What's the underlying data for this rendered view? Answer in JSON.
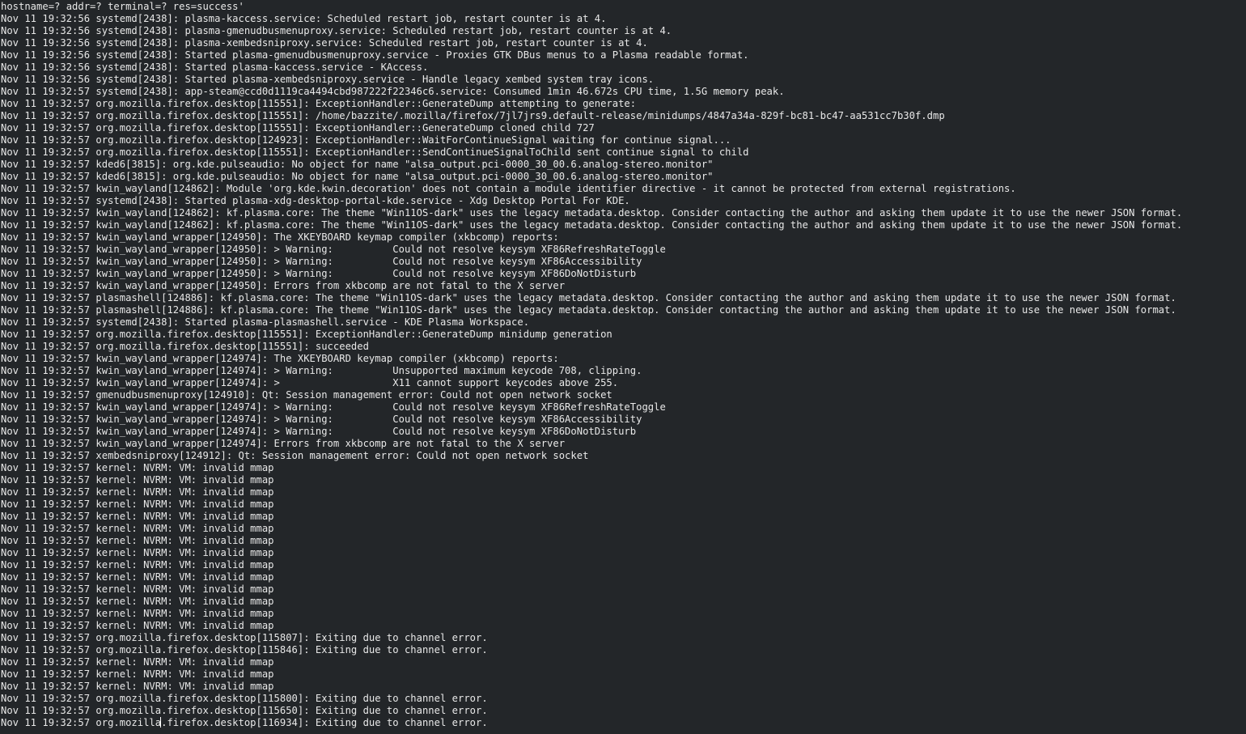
{
  "terminal": {
    "lines": [
      "hostname=? addr=? terminal=? res=success'",
      "Nov 11 19:32:56 systemd[2438]: plasma-kaccess.service: Scheduled restart job, restart counter is at 4.",
      "Nov 11 19:32:56 systemd[2438]: plasma-gmenudbusmenuproxy.service: Scheduled restart job, restart counter is at 4.",
      "Nov 11 19:32:56 systemd[2438]: plasma-xembedsniproxy.service: Scheduled restart job, restart counter is at 4.",
      "Nov 11 19:32:56 systemd[2438]: Started plasma-gmenudbusmenuproxy.service - Proxies GTK DBus menus to a Plasma readable format.",
      "Nov 11 19:32:56 systemd[2438]: Started plasma-kaccess.service - KAccess.",
      "Nov 11 19:32:56 systemd[2438]: Started plasma-xembedsniproxy.service - Handle legacy xembed system tray icons.",
      "Nov 11 19:32:57 systemd[2438]: app-steam@ccd0d1119ca4494cbd987222f22346c6.service: Consumed 1min 46.672s CPU time, 1.5G memory peak.",
      "Nov 11 19:32:57 org.mozilla.firefox.desktop[115551]: ExceptionHandler::GenerateDump attempting to generate:",
      "Nov 11 19:32:57 org.mozilla.firefox.desktop[115551]: /home/bazzite/.mozilla/firefox/7jl7jrs9.default-release/minidumps/4847a34a-829f-bc81-bc47-aa531cc7b30f.dmp",
      "Nov 11 19:32:57 org.mozilla.firefox.desktop[115551]: ExceptionHandler::GenerateDump cloned child 727",
      "Nov 11 19:32:57 org.mozilla.firefox.desktop[124923]: ExceptionHandler::WaitForContinueSignal waiting for continue signal...",
      "Nov 11 19:32:57 org.mozilla.firefox.desktop[115551]: ExceptionHandler::SendContinueSignalToChild sent continue signal to child",
      "Nov 11 19:32:57 kded6[3815]: org.kde.pulseaudio: No object for name \"alsa_output.pci-0000_30_00.6.analog-stereo.monitor\"",
      "Nov 11 19:32:57 kded6[3815]: org.kde.pulseaudio: No object for name \"alsa_output.pci-0000_30_00.6.analog-stereo.monitor\"",
      "Nov 11 19:32:57 kwin_wayland[124862]: Module 'org.kde.kwin.decoration' does not contain a module identifier directive - it cannot be protected from external registrations.",
      "Nov 11 19:32:57 systemd[2438]: Started plasma-xdg-desktop-portal-kde.service - Xdg Desktop Portal For KDE.",
      "Nov 11 19:32:57 kwin_wayland[124862]: kf.plasma.core: The theme \"Win11OS-dark\" uses the legacy metadata.desktop. Consider contacting the author and asking them update it to use the newer JSON format.",
      "Nov 11 19:32:57 kwin_wayland[124862]: kf.plasma.core: The theme \"Win11OS-dark\" uses the legacy metadata.desktop. Consider contacting the author and asking them update it to use the newer JSON format.",
      "Nov 11 19:32:57 kwin_wayland_wrapper[124950]: The XKEYBOARD keymap compiler (xkbcomp) reports:",
      "Nov 11 19:32:57 kwin_wayland_wrapper[124950]: > Warning:          Could not resolve keysym XF86RefreshRateToggle",
      "Nov 11 19:32:57 kwin_wayland_wrapper[124950]: > Warning:          Could not resolve keysym XF86Accessibility",
      "Nov 11 19:32:57 kwin_wayland_wrapper[124950]: > Warning:          Could not resolve keysym XF86DoNotDisturb",
      "Nov 11 19:32:57 kwin_wayland_wrapper[124950]: Errors from xkbcomp are not fatal to the X server",
      "Nov 11 19:32:57 plasmashell[124886]: kf.plasma.core: The theme \"Win11OS-dark\" uses the legacy metadata.desktop. Consider contacting the author and asking them update it to use the newer JSON format.",
      "Nov 11 19:32:57 plasmashell[124886]: kf.plasma.core: The theme \"Win11OS-dark\" uses the legacy metadata.desktop. Consider contacting the author and asking them update it to use the newer JSON format.",
      "Nov 11 19:32:57 systemd[2438]: Started plasma-plasmashell.service - KDE Plasma Workspace.",
      "Nov 11 19:32:57 org.mozilla.firefox.desktop[115551]: ExceptionHandler::GenerateDump minidump generation",
      "Nov 11 19:32:57 org.mozilla.firefox.desktop[115551]: succeeded",
      "Nov 11 19:32:57 kwin_wayland_wrapper[124974]: The XKEYBOARD keymap compiler (xkbcomp) reports:",
      "Nov 11 19:32:57 kwin_wayland_wrapper[124974]: > Warning:          Unsupported maximum keycode 708, clipping.",
      "Nov 11 19:32:57 kwin_wayland_wrapper[124974]: >                   X11 cannot support keycodes above 255.",
      "Nov 11 19:32:57 gmenudbusmenuproxy[124910]: Qt: Session management error: Could not open network socket",
      "Nov 11 19:32:57 kwin_wayland_wrapper[124974]: > Warning:          Could not resolve keysym XF86RefreshRateToggle",
      "Nov 11 19:32:57 kwin_wayland_wrapper[124974]: > Warning:          Could not resolve keysym XF86Accessibility",
      "Nov 11 19:32:57 kwin_wayland_wrapper[124974]: > Warning:          Could not resolve keysym XF86DoNotDisturb",
      "Nov 11 19:32:57 kwin_wayland_wrapper[124974]: Errors from xkbcomp are not fatal to the X server",
      "Nov 11 19:32:57 xembedsniproxy[124912]: Qt: Session management error: Could not open network socket",
      "Nov 11 19:32:57 kernel: NVRM: VM: invalid mmap",
      "Nov 11 19:32:57 kernel: NVRM: VM: invalid mmap",
      "Nov 11 19:32:57 kernel: NVRM: VM: invalid mmap",
      "Nov 11 19:32:57 kernel: NVRM: VM: invalid mmap",
      "Nov 11 19:32:57 kernel: NVRM: VM: invalid mmap",
      "Nov 11 19:32:57 kernel: NVRM: VM: invalid mmap",
      "Nov 11 19:32:57 kernel: NVRM: VM: invalid mmap",
      "Nov 11 19:32:57 kernel: NVRM: VM: invalid mmap",
      "Nov 11 19:32:57 kernel: NVRM: VM: invalid mmap",
      "Nov 11 19:32:57 kernel: NVRM: VM: invalid mmap",
      "Nov 11 19:32:57 kernel: NVRM: VM: invalid mmap",
      "Nov 11 19:32:57 kernel: NVRM: VM: invalid mmap",
      "Nov 11 19:32:57 kernel: NVRM: VM: invalid mmap",
      "Nov 11 19:32:57 kernel: NVRM: VM: invalid mmap",
      "Nov 11 19:32:57 org.mozilla.firefox.desktop[115807]: Exiting due to channel error.",
      "Nov 11 19:32:57 org.mozilla.firefox.desktop[115846]: Exiting due to channel error.",
      "Nov 11 19:32:57 kernel: NVRM: VM: invalid mmap",
      "Nov 11 19:32:57 kernel: NVRM: VM: invalid mmap",
      "Nov 11 19:32:57 kernel: NVRM: VM: invalid mmap",
      "Nov 11 19:32:57 org.mozilla.firefox.desktop[115800]: Exiting due to channel error.",
      "Nov 11 19:32:57 org.mozilla.firefox.desktop[115650]: Exiting due to channel error.",
      "Nov 11 19:32:57 org.mozilla.firefox.desktop[116934]: Exiting due to channel error."
    ]
  }
}
